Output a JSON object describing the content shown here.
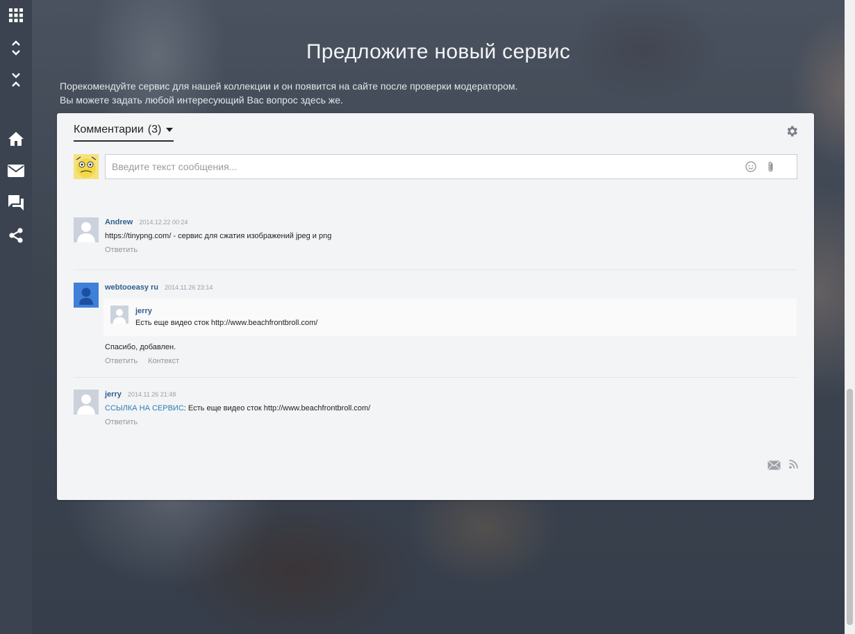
{
  "hero": {
    "title": "Предложите новый сервис",
    "desc_line1": "Порекомендуйте сервис для нашей коллекции и он появится на сайте после проверки модератором.",
    "desc_line2": "Вы можете задать любой интересующий Вас вопрос здесь же."
  },
  "sidebar": {
    "icons": [
      "apps-icon",
      "expand-icon",
      "collapse-icon",
      "home-icon",
      "mail-icon",
      "chat-icon",
      "share-icon"
    ]
  },
  "comments_widget": {
    "tab_label": "Комментарии",
    "count": "(3)",
    "input_placeholder": "Введите текст сообщения...",
    "comments": [
      {
        "author": "Andrew",
        "date": "2014.12.22 00:24",
        "text": "https://tinypng.com/ - сервис для сжатия изображений jpeg и png",
        "reply_label": "Ответить"
      },
      {
        "author": "webtooeasy ru",
        "date": "2014.11.26 23:14",
        "quote_author": "jerry",
        "quote_text": "Есть еще видео сток http://www.beachfrontbroll.com/",
        "text": "Спасибо, добавлен.",
        "reply_label": "Ответить",
        "context_label": "Контекст"
      },
      {
        "author": "jerry",
        "date": "2014.11.26 21:48",
        "link_text": "ССЫЛКА НА СЕРВИС",
        "text": ": Есть еще видео сток http://www.beachfrontbroll.com/",
        "reply_label": "Ответить"
      }
    ]
  },
  "colors": {
    "sidebar_bg": "#3b4350",
    "card_bg": "#f3f4f6",
    "author_link": "#2f5e8e",
    "service_link": "#2a7bb5"
  }
}
